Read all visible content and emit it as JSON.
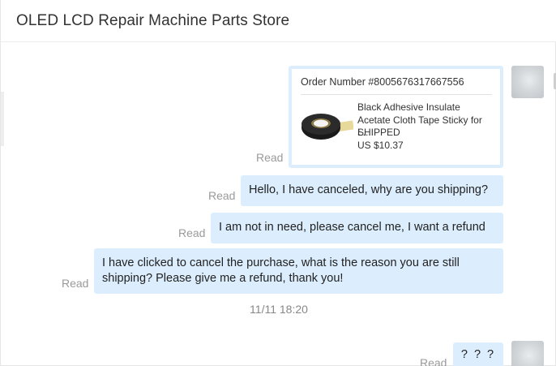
{
  "header": {
    "title": "OLED LCD Repair Machine Parts Store"
  },
  "order": {
    "number_label": "Order Number #8005676317667556",
    "product_name": "Black Adhesive Insulate Acetate Cloth Tape Sticky for L...",
    "status": "SHIPPED",
    "price": "US $10.37",
    "read_label": "Read"
  },
  "messages": [
    {
      "text": "Hello, I have canceled, why are you shipping?",
      "read_label": "Read"
    },
    {
      "text": "I am not in need, please cancel me, I want a refund",
      "read_label": "Read"
    },
    {
      "text": "I have clicked to cancel the purchase, what is the reason you are still shipping? Please give me a refund, thank you!",
      "read_label": "Read"
    },
    {
      "text": "? ? ?",
      "read_label": "Read"
    }
  ],
  "timestamp": "11/11 18:20"
}
